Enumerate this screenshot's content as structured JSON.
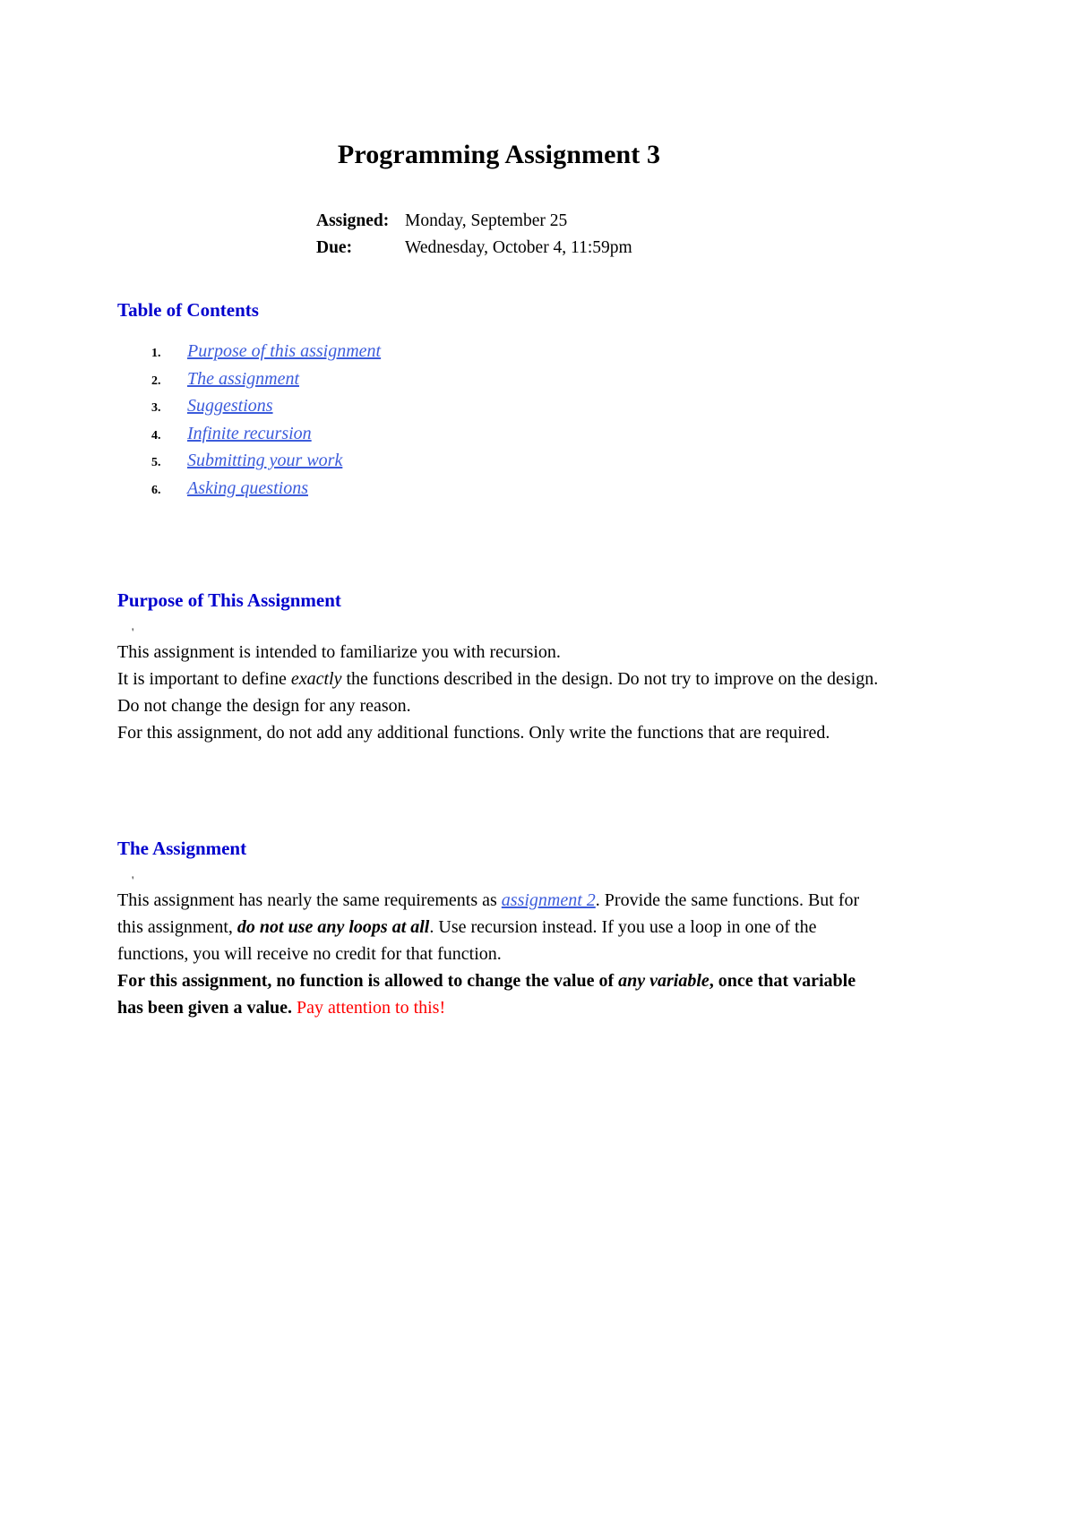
{
  "document": {
    "title": "Programming Assignment 3",
    "meta": {
      "assigned_label": "Assigned:",
      "assigned_value": "Monday, September 25",
      "due_label": "Due:",
      "due_value": "Wednesday, October 4, 11:59pm"
    },
    "toc": {
      "heading": "Table of Contents",
      "items": [
        {
          "number": "1.",
          "label": "Purpose of this assignment"
        },
        {
          "number": "2.",
          "label": "The assignment"
        },
        {
          "number": "3.",
          "label": "Suggestions"
        },
        {
          "number": "4.",
          "label": "Infinite recursion"
        },
        {
          "number": "5.",
          "label": "Submitting your work"
        },
        {
          "number": "6.",
          "label": "Asking questions"
        }
      ]
    },
    "sections": [
      {
        "heading": "Purpose of This Assignment",
        "stray_mark": "'",
        "paragraphs": {
          "p1": "This assignment is intended to familiarize you with recursion.",
          "p2_a": "It is important to define ",
          "p2_em": "exactly",
          "p2_b": " the functions described in the design. Do not try to improve on the design. Do not change the design for any reason.",
          "p3": "For this assignment, do not add any additional functions. Only write the functions that are required."
        }
      },
      {
        "heading": "The Assignment",
        "stray_mark": "'",
        "paragraphs": {
          "p1_a": "This assignment has nearly the same requirements as ",
          "p1_link": "assignment 2",
          "p1_b": ". Provide the same functions. But for this assignment, ",
          "p1_em": "do not use any loops at all",
          "p1_c": ". Use recursion instead. If you use a loop in one of the functions, you will receive no credit for that function.",
          "p2_a": "For this assignment, no function is allowed to change the value of ",
          "p2_em": "any variable",
          "p2_b": ", once that variable has been given a value. ",
          "p2_red": "Pay attention to this!"
        }
      }
    ],
    "colors": {
      "heading": "#0000cd",
      "link": "#3b5bdb",
      "alert": "#ff0000",
      "text": "#000000",
      "background": "#ffffff"
    }
  }
}
